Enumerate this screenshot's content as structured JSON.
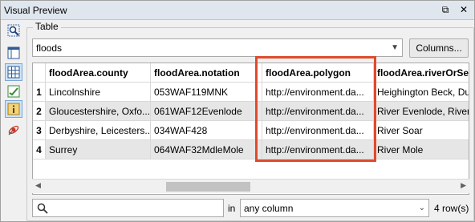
{
  "window": {
    "title": "Visual Preview",
    "float_glyph": "⧉",
    "close_glyph": "✕"
  },
  "toolbar": {
    "tools": [
      "zoom-selection-icon",
      "layout-icon",
      "table-icon",
      "chart-check-icon",
      "info-icon",
      "satellite-icon"
    ]
  },
  "group": {
    "label": "Table"
  },
  "table_select": {
    "value": "floods"
  },
  "columns_button": {
    "label": "Columns..."
  },
  "table": {
    "headers": [
      "floodArea.county",
      "floodArea.notation",
      "floodArea.polygon",
      "floodArea.riverOrSea"
    ],
    "rows": [
      {
        "num": "1",
        "cells": [
          "Lincolnshire",
          "053WAF119MNK",
          "http://environment.da...",
          "Heighington Beck, Du"
        ]
      },
      {
        "num": "2",
        "cells": [
          "Gloucestershire, Oxfo...",
          "061WAF12Evenlode",
          "http://environment.da...",
          "River Evenlode, River C"
        ]
      },
      {
        "num": "3",
        "cells": [
          "Derbyshire, Leicesters...",
          "034WAF428",
          "http://environment.da...",
          "River Soar"
        ]
      },
      {
        "num": "4",
        "cells": [
          "Surrey",
          "064WAF32MdleMole",
          "http://environment.da...",
          "River Mole"
        ]
      }
    ]
  },
  "filter": {
    "search_value": "",
    "in_label": "in",
    "column_value": "any column",
    "row_count": "4 row(s)"
  },
  "colors": {
    "highlight": "#e04a2c",
    "selected_tool": "#cde3f7"
  }
}
